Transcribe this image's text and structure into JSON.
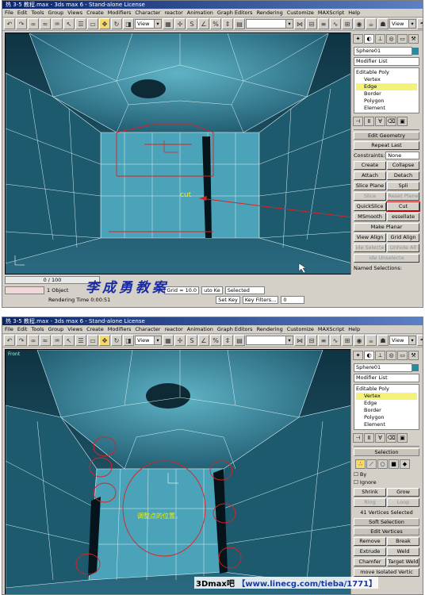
{
  "shot1": {
    "title": "热 3-5 教程.max - 3ds max 6 - Stand-alone License",
    "menu": [
      "File",
      "Edit",
      "Tools",
      "Group",
      "Views",
      "Create",
      "Modifiers",
      "Character",
      "reactor",
      "Animation",
      "Graph Editors",
      "Rendering",
      "Customize",
      "MAXScript",
      "Help"
    ],
    "view_combo": "View",
    "object_name": "Sphere01",
    "modifier_list": "Modifier List",
    "stack": {
      "root": "Editable Poly",
      "items": [
        "Vertex",
        "Edge",
        "Border",
        "Polygon",
        "Element"
      ],
      "selected": "Edge"
    },
    "edit_geometry": {
      "title": "Edit Geometry",
      "repeat_last": "Repeat Last",
      "constraints_label": "Constraints:",
      "constraints_value": "None",
      "create": "Create",
      "collapse": "Collapse",
      "attach": "Attach",
      "detach": "Detach",
      "slice_plane": "Slice Plane",
      "split": "Spli",
      "slice": "Slice",
      "reset_plane": "Reset Plane",
      "quickslice": "QuickSlice",
      "cut": "Cut",
      "msmooth": "MSmooth",
      "tessellate": "essellate",
      "make_planar": "Make Planar",
      "view_align": "View Align",
      "grid_align": "Grid Align",
      "hide_selected": "ide Selecte",
      "unhide_all": "Unhide All",
      "hide_unselected": "ide Unselecte",
      "named_selections": "Named Selections:"
    },
    "annotation": "cut",
    "frame_slider": "0 / 100",
    "status": {
      "objects": "1 Object",
      "render_time": "Rendering Time  0:00:51",
      "grid": "Grid = 10.0",
      "auto_key": "uto Ke",
      "selected": "Selected",
      "set_key": "Set Key",
      "key_filters": "Key Filters...",
      "frame": "0"
    },
    "watermark": "李成勇教案"
  },
  "shot2": {
    "title": "热 3-5 教程.max - 3ds max 6 - Stand-alone License",
    "view_combo": "View",
    "viewport_label": "Front",
    "object_name": "Sphere01",
    "modifier_list": "Modifier List",
    "stack": {
      "root": "Editable Poly",
      "items": [
        "Vertex",
        "Edge",
        "Border",
        "Polygon",
        "Element"
      ],
      "selected": "Vertex"
    },
    "selection": {
      "title": "Selection",
      "by": "By",
      "ignore": "Ignore",
      "shrink": "Shrink",
      "grow": "Grow",
      "ring": "Ring",
      "loop": "Loop",
      "count": "41 Vertices Selected"
    },
    "soft_selection": "Soft Selection",
    "edit_vertices": {
      "title": "Edit Vertices",
      "remove": "Remove",
      "break": "Break",
      "extrude": "Extrude",
      "weld": "Weld",
      "chamfer": "Chamfer",
      "target_weld": "Target Weld",
      "remove_isolated": "move Isolated Vertic"
    },
    "annotation": "调整点的位置。"
  },
  "footer": {
    "brand": "3Dmax吧",
    "url": "【www.linecg.com/tieba/1771】"
  },
  "colors": {
    "mesh": "#2a8fa8",
    "annotation": "#e02020",
    "highlight": "#f5f27a",
    "watermark": "#1a2aa0"
  }
}
